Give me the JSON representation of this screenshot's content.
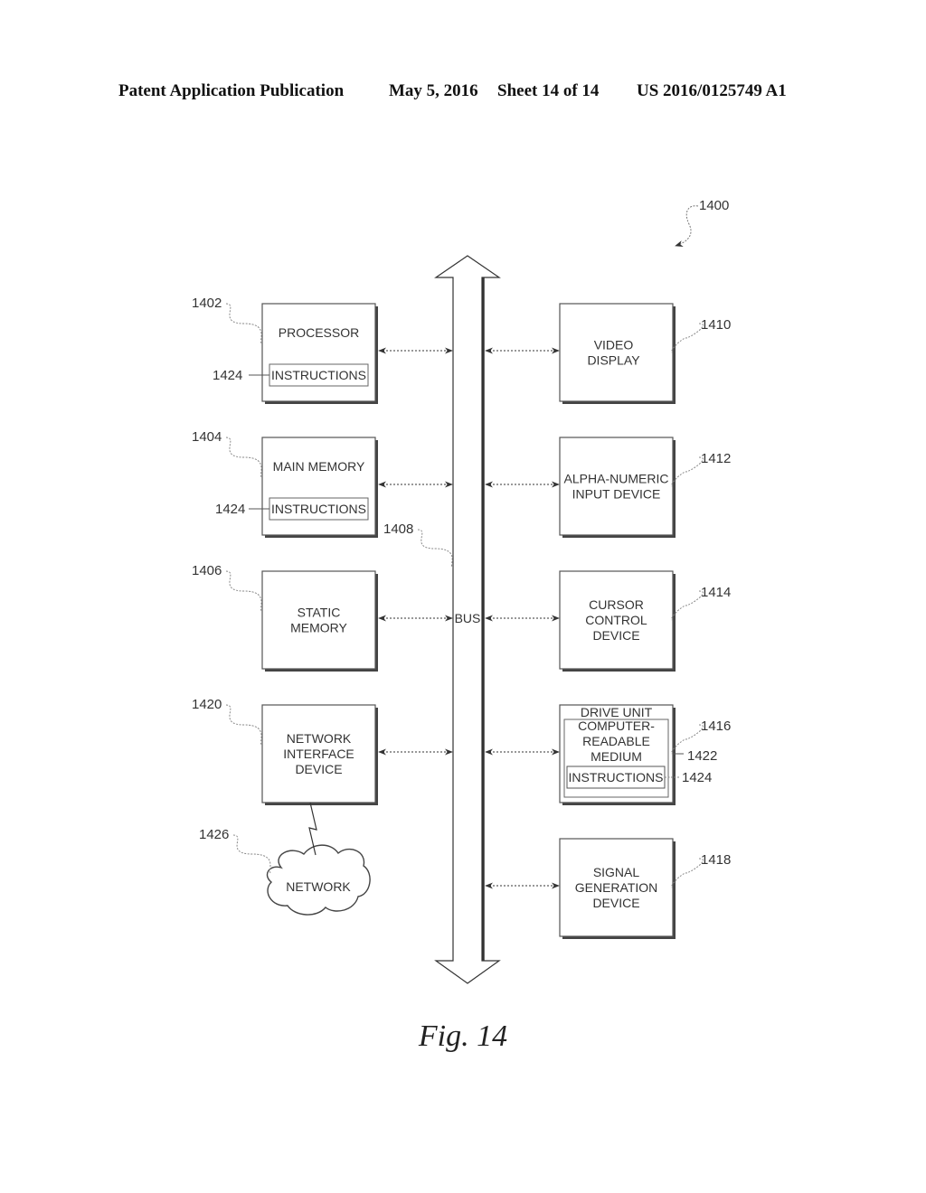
{
  "header": {
    "publication": "Patent Application Publication",
    "date": "May 5, 2016",
    "sheet": "Sheet 14 of 14",
    "number": "US 2016/0125749 A1"
  },
  "figure": {
    "caption": "Fig. 14",
    "system_ref": "1400",
    "bus": {
      "label": "BUS",
      "ref": "1408"
    },
    "left_blocks": [
      {
        "id": "processor",
        "lines": [
          "PROCESSOR"
        ],
        "ref": "1402",
        "inner": {
          "label": "INSTRUCTIONS",
          "ref": "1424"
        }
      },
      {
        "id": "main-memory",
        "lines": [
          "MAIN MEMORY"
        ],
        "ref": "1404",
        "inner": {
          "label": "INSTRUCTIONS",
          "ref": "1424"
        }
      },
      {
        "id": "static-memory",
        "lines": [
          "STATIC",
          "MEMORY"
        ],
        "ref": "1406"
      },
      {
        "id": "network-interface-device",
        "lines": [
          "NETWORK",
          "INTERFACE",
          "DEVICE"
        ],
        "ref": "1420"
      }
    ],
    "right_blocks": [
      {
        "id": "video-display",
        "lines": [
          "VIDEO",
          "DISPLAY"
        ],
        "ref": "1410"
      },
      {
        "id": "alpha-numeric-input-device",
        "lines": [
          "ALPHA-NUMERIC",
          "INPUT DEVICE"
        ],
        "ref": "1412"
      },
      {
        "id": "cursor-control-device",
        "lines": [
          "CURSOR",
          "CONTROL",
          "DEVICE"
        ],
        "ref": "1414"
      },
      {
        "id": "drive-unit",
        "lines": [
          "DRIVE UNIT"
        ],
        "ref": "1416",
        "medium": {
          "lines": [
            "COMPUTER-",
            "READABLE",
            "MEDIUM"
          ],
          "ref": "1422"
        },
        "inner": {
          "label": "INSTRUCTIONS",
          "ref": "1424"
        }
      },
      {
        "id": "signal-generation-device",
        "lines": [
          "SIGNAL",
          "GENERATION",
          "DEVICE"
        ],
        "ref": "1418"
      }
    ],
    "network": {
      "label": "NETWORK",
      "ref": "1426"
    }
  }
}
